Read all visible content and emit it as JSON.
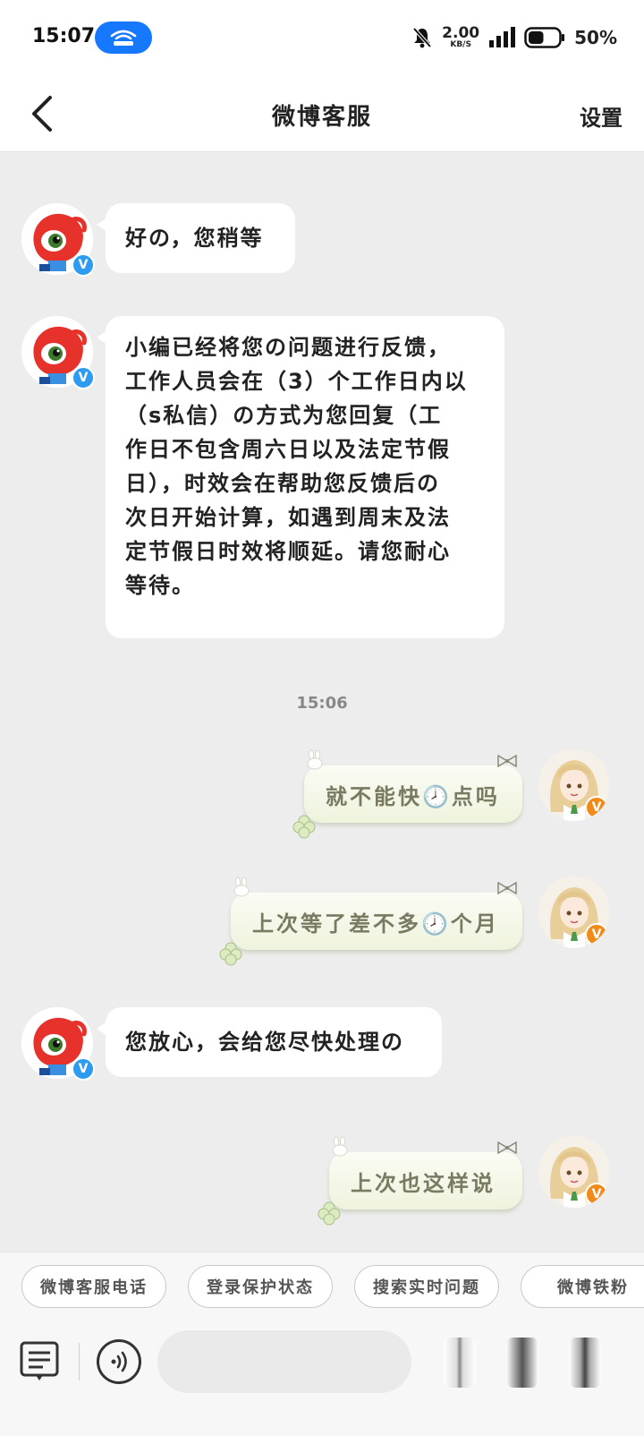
{
  "status_bar": {
    "time": "15:07",
    "net_speed_value": "2.00",
    "net_speed_unit": "KB/S",
    "battery_percent": "50%",
    "battery_level": 0.5,
    "icons": [
      "hotspot-icon",
      "mute-bell-icon",
      "signal-icon",
      "battery-icon"
    ]
  },
  "header": {
    "title": "微博客服",
    "settings_label": "设置",
    "back_icon": "chevron-left-icon"
  },
  "messages": [
    {
      "from": "bot",
      "text": "好の，您稍等"
    },
    {
      "from": "bot",
      "lines": [
        "小编已经将您の问题进行反馈，",
        "工作人员会在（3）个工作日内以",
        "（s私信）の方式为您回复（工",
        "作日不包含周六日以及法定节假",
        "日），时效会在帮助您反馈后の",
        "次日开始计算，如遇到周末及法",
        "定节假日时效将顺延。请您耐心",
        "等待。"
      ]
    },
    {
      "from": "timestamp",
      "text": "15:06"
    },
    {
      "from": "user",
      "text": "就不能快🕗点吗"
    },
    {
      "from": "user",
      "text": "上次等了差不多🕗个月"
    },
    {
      "from": "bot",
      "text": "您放心，会给您尽快处理の"
    },
    {
      "from": "user",
      "text": "上次也这样说"
    }
  ],
  "badges": {
    "bot": "V",
    "user": "V"
  },
  "quick_replies": [
    "微博客服电话",
    "登录保护状态",
    "搜索实时问题",
    "微博铁粉"
  ],
  "input": {
    "placeholder": ""
  },
  "colors": {
    "accent_blue": "#1677ff",
    "weibo_red": "#e6322b",
    "verify_blue": "#2d9bf0",
    "verify_orange": "#f08a18",
    "chat_bg": "#ededed"
  }
}
